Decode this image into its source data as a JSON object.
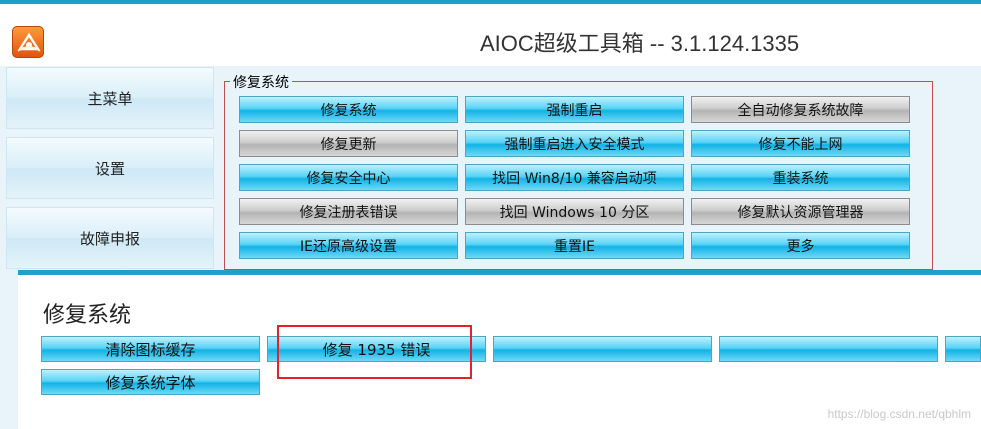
{
  "window": {
    "title": "AIOC超级工具箱 -- 3.1.124.1335",
    "icon": "app-logo-icon"
  },
  "sidebar": {
    "items": [
      {
        "label": "主菜单"
      },
      {
        "label": "设置"
      },
      {
        "label": "故障申报"
      }
    ]
  },
  "repair_group": {
    "legend": "修复系统",
    "buttons": [
      {
        "label": "修复系统",
        "style": "blue"
      },
      {
        "label": "强制重启",
        "style": "blue"
      },
      {
        "label": "全自动修复系统故障",
        "style": "gray"
      },
      {
        "label": "修复更新",
        "style": "gray"
      },
      {
        "label": "强制重启进入安全模式",
        "style": "blue"
      },
      {
        "label": "修复不能上网",
        "style": "blue"
      },
      {
        "label": "修复安全中心",
        "style": "blue"
      },
      {
        "label": "找回 Win8/10 兼容启动项",
        "style": "blue"
      },
      {
        "label": "重装系统",
        "style": "blue"
      },
      {
        "label": "修复注册表错误",
        "style": "gray"
      },
      {
        "label": "找回 Windows 10 分区",
        "style": "gray"
      },
      {
        "label": "修复默认资源管理器",
        "style": "gray"
      },
      {
        "label": "IE还原高级设置",
        "style": "blue"
      },
      {
        "label": "重置IE",
        "style": "blue"
      },
      {
        "label": "更多",
        "style": "blue"
      }
    ]
  },
  "popup": {
    "title": "修复系统",
    "buttons": [
      {
        "label": "清除图标缓存"
      },
      {
        "label": "修复 1935 错误"
      },
      {
        "label": ""
      },
      {
        "label": ""
      },
      {
        "label": ""
      },
      {
        "label": "修复系统字体"
      }
    ]
  },
  "watermark": "https://blog.csdn.net/qbhlm",
  "colors": {
    "accent": "#1ea0c8",
    "button_blue": "#12b3e6",
    "button_gray": "#b4b4b4",
    "group_border": "#c0504d",
    "highlight": "#e8202a"
  }
}
